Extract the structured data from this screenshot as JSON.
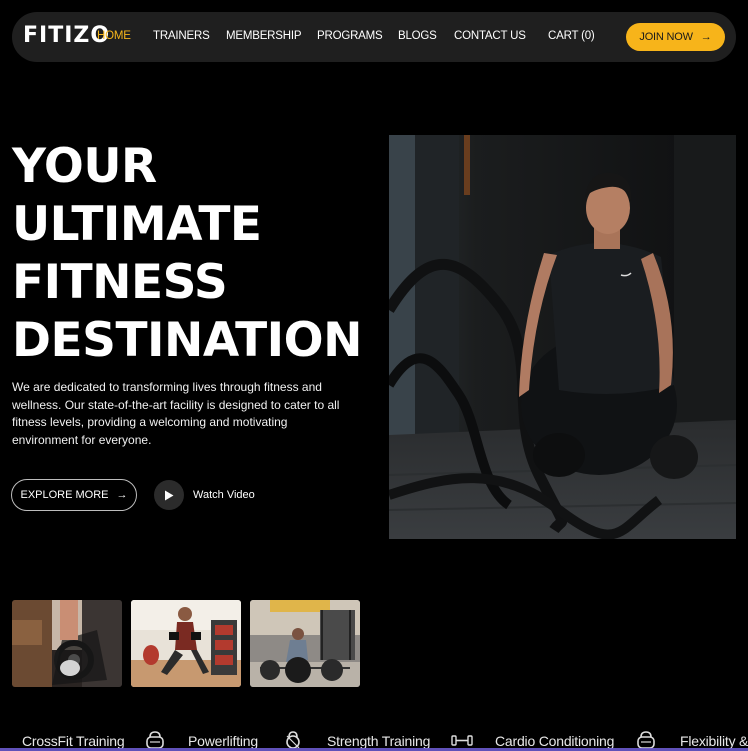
{
  "nav": {
    "logo": "FITIZO",
    "links": [
      "HOME",
      "TRAINERS",
      "MEMBERSHIP",
      "PROGRAMS",
      "BLOGS",
      "CONTACT US",
      "CART (0)"
    ],
    "active_link": "HOME",
    "cta_label": "JOIN NOW",
    "cta_arrow": "→"
  },
  "hero": {
    "title_lines": [
      "YOUR",
      "ULTIMATE",
      "FITNESS",
      "DESTINATION"
    ],
    "description": "We are dedicated to transforming lives through fitness and wellness. Our state-of-the-art facility is designed to cater to all fitness levels, providing a welcoming and motivating environment for everyone.",
    "explore_label": "EXPLORE MORE",
    "explore_arrow": "→",
    "watch_label": "Watch Video"
  },
  "marquee": {
    "items": [
      "CrossFit Training",
      "Powerlifting",
      "Strength Training",
      "Cardio Conditioning",
      "Flexibility &"
    ]
  },
  "colors": {
    "accent": "#f7b41a",
    "background": "#000000",
    "nav_bg": "#1f1f1f"
  },
  "icons": [
    "arrow-right-icon",
    "play-icon",
    "kettlebell-icon",
    "dumbbell-icon"
  ]
}
